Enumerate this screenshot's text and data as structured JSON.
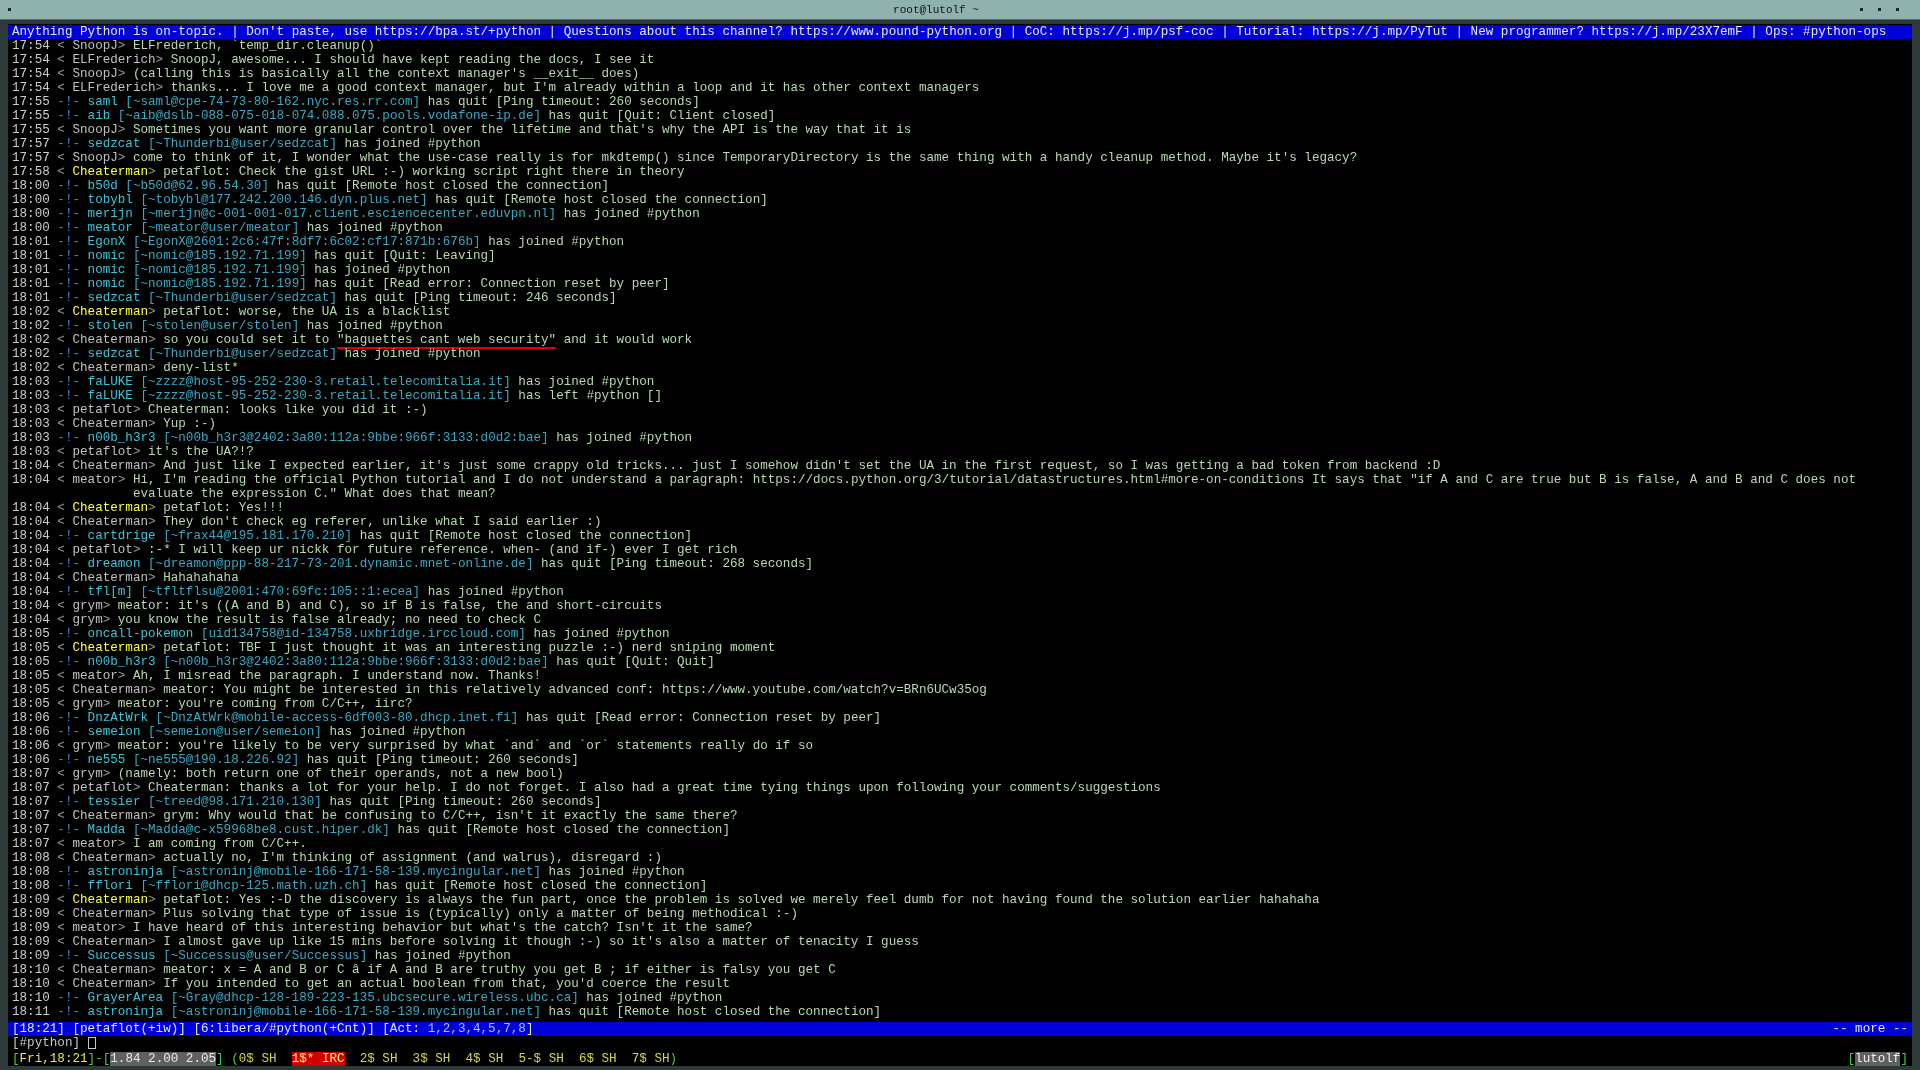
{
  "window": {
    "title": "root@lutolf ~"
  },
  "topic": "Anything Python is on-topic. | Don't paste, use https://bpa.st/+python | Questions about this channel? https://www.pound-python.org | CoC: https://j.mp/psf-coc | Tutorial: https://j.mp/PyTut | New programmer? https://j.mp/23X7emF | Ops: #python-ops",
  "lines": [
    {
      "kind": "msg",
      "time": "17:54",
      "open": "<",
      "nick": "SnoopJ",
      "close": ">",
      "text": "ELFrederich, `temp_dir.cleanup()`",
      "highlight": false
    },
    {
      "kind": "msg",
      "time": "17:54",
      "open": "<",
      "nick": "ELFrederich",
      "close": ">",
      "text": "SnoopJ, awesome... I should have kept reading the docs, I see it",
      "highlight": false
    },
    {
      "kind": "msg",
      "time": "17:54",
      "open": "<",
      "nick": "SnoopJ",
      "close": ">",
      "text": "(calling this is basically all the context manager's __exit__ does)",
      "highlight": false
    },
    {
      "kind": "msg",
      "time": "17:54",
      "open": "<",
      "nick": "ELFrederich",
      "close": ">",
      "text": "thanks... I love me a good context manager, but I'm already within a loop and it has other context managers",
      "highlight": false
    },
    {
      "kind": "event",
      "time": "17:55",
      "marker": "-!-",
      "nick": "saml",
      "host": "[~saml@cpe-74-73-80-162.nyc.res.rr.com]",
      "action": "has quit",
      "reason": "[Ping timeout: 260 seconds]"
    },
    {
      "kind": "event",
      "time": "17:55",
      "marker": "-!-",
      "nick": "aib",
      "host": "[~aib@dslb-088-075-018-074.088.075.pools.vodafone-ip.de]",
      "action": "has quit",
      "reason": "[Quit: Client closed]"
    },
    {
      "kind": "msg",
      "time": "17:55",
      "open": "<",
      "nick": "SnoopJ",
      "close": ">",
      "text": "Sometimes you want more granular control over the lifetime and that's why the API is the way that it is",
      "highlight": false
    },
    {
      "kind": "event",
      "time": "17:57",
      "marker": "-!-",
      "nick": "sedzcat",
      "host": "[~Thunderbi@user/sedzcat]",
      "action": "has joined #python"
    },
    {
      "kind": "msg",
      "time": "17:57",
      "open": "<",
      "nick": "SnoopJ",
      "close": ">",
      "text": "come to think of it, I wonder what the use-case really is for mkdtemp() since TemporaryDirectory is the same thing with a handy cleanup method. Maybe it's legacy?",
      "highlight": false
    },
    {
      "kind": "msg",
      "time": "17:58",
      "open": "<",
      "nick": "Cheaterman",
      "close": ">",
      "text": "petaflot: Check the gist URL :-) working script right there in theory",
      "highlight": true
    },
    {
      "kind": "event",
      "time": "18:00",
      "marker": "-!-",
      "nick": "b50d",
      "host": "[~b50d@62.96.54.30]",
      "action": "has quit",
      "reason": "[Remote host closed the connection]"
    },
    {
      "kind": "event",
      "time": "18:00",
      "marker": "-!-",
      "nick": "tobybl",
      "host": "[~tobybl@177.242.200.146.dyn.plus.net]",
      "action": "has quit",
      "reason": "[Remote host closed the connection]"
    },
    {
      "kind": "event",
      "time": "18:00",
      "marker": "-!-",
      "nick": "merijn",
      "host": "[~merijn@c-001-001-017.client.esciencecenter.eduvpn.nl]",
      "action": "has joined #python"
    },
    {
      "kind": "event",
      "time": "18:00",
      "marker": "-!-",
      "nick": "meator",
      "host": "[~meator@user/meator]",
      "action": "has joined #python"
    },
    {
      "kind": "event",
      "time": "18:01",
      "marker": "-!-",
      "nick": "EgonX",
      "host": "[~EgonX@2601:2c6:47f:8df7:6c02:cf17:871b:676b]",
      "action": "has joined #python"
    },
    {
      "kind": "event",
      "time": "18:01",
      "marker": "-!-",
      "nick": "nomic",
      "host": "[~nomic@185.192.71.199]",
      "action": "has quit",
      "reason": "[Quit: Leaving]"
    },
    {
      "kind": "event",
      "time": "18:01",
      "marker": "-!-",
      "nick": "nomic",
      "host": "[~nomic@185.192.71.199]",
      "action": "has joined #python"
    },
    {
      "kind": "event",
      "time": "18:01",
      "marker": "-!-",
      "nick": "nomic",
      "host": "[~nomic@185.192.71.199]",
      "action": "has quit",
      "reason": "[Read error: Connection reset by peer]"
    },
    {
      "kind": "event",
      "time": "18:01",
      "marker": "-!-",
      "nick": "sedzcat",
      "host": "[~Thunderbi@user/sedzcat]",
      "action": "has quit",
      "reason": "[Ping timeout: 246 seconds]"
    },
    {
      "kind": "msg",
      "time": "18:02",
      "open": "<",
      "nick": "Cheaterman",
      "close": ">",
      "text": "petaflot: worse, the UA is a blacklist",
      "highlight": true
    },
    {
      "kind": "event",
      "time": "18:02",
      "marker": "-!-",
      "nick": "stolen",
      "host": "[~stolen@user/stolen]",
      "action": "has joined #python"
    },
    {
      "kind": "msg",
      "time": "18:02",
      "open": "<",
      "nick": "Cheaterman",
      "close": ">",
      "text": "so you could set it to",
      "underlined": "\"baguettes cant web security\"",
      "text_after": "and it would work",
      "highlight": false
    },
    {
      "kind": "event",
      "time": "18:02",
      "marker": "-!-",
      "nick": "sedzcat",
      "host": "[~Thunderbi@user/sedzcat]",
      "action": "has joined #python"
    },
    {
      "kind": "msg",
      "time": "18:02",
      "open": "<",
      "nick": "Cheaterman",
      "close": ">",
      "text": "deny-list*",
      "highlight": false
    },
    {
      "kind": "event",
      "time": "18:03",
      "marker": "-!-",
      "nick": "faLUKE",
      "host": "[~zzzz@host-95-252-230-3.retail.telecomitalia.it]",
      "action": "has joined #python"
    },
    {
      "kind": "event",
      "time": "18:03",
      "marker": "-!-",
      "nick": "faLUKE",
      "host": "[~zzzz@host-95-252-230-3.retail.telecomitalia.it]",
      "action": "has left #python",
      "reason": "[]"
    },
    {
      "kind": "msg",
      "time": "18:03",
      "open": "<",
      "nick": "petaflot",
      "close": ">",
      "text": "Cheaterman: looks like you did it :-)",
      "highlight": false
    },
    {
      "kind": "msg",
      "time": "18:03",
      "open": "<",
      "nick": "Cheaterman",
      "close": ">",
      "text": "Yup :-)",
      "highlight": false
    },
    {
      "kind": "event",
      "time": "18:03",
      "marker": "-!-",
      "nick": "n00b_h3r3",
      "host": "[~n00b_h3r3@2402:3a80:112a:9bbe:966f:3133:d0d2:bae]",
      "action": "has joined #python"
    },
    {
      "kind": "msg",
      "time": "18:03",
      "open": "<",
      "nick": "petaflot",
      "close": ">",
      "text": "it's the UA?!?",
      "highlight": false
    },
    {
      "kind": "msg",
      "time": "18:04",
      "open": "<",
      "nick": "Cheaterman",
      "close": ">",
      "text": "And just like I expected earlier, it's just some crappy old tricks... just I somehow didn't set the UA in the first request, so I was getting a bad token from backend :D",
      "highlight": false
    },
    {
      "kind": "msg",
      "time": "18:04",
      "open": "<",
      "nick": "meator",
      "close": ">",
      "text": "Hi, I'm reading the official Python tutorial and I do not understand a paragraph: https://docs.python.org/3/tutorial/datastructures.html#more-on-conditions It says that \"if A and C are true but B is false, A and B and C does not evaluate the expression C.\" What does that mean?",
      "highlight": false
    },
    {
      "kind": "msg",
      "time": "18:04",
      "open": "<",
      "nick": "Cheaterman",
      "close": ">",
      "text": "petaflot: Yes!!!",
      "highlight": true
    },
    {
      "kind": "msg",
      "time": "18:04",
      "open": "<",
      "nick": "Cheaterman",
      "close": ">",
      "text": "They don't check eg referer, unlike what I said earlier :)",
      "highlight": false
    },
    {
      "kind": "event",
      "time": "18:04",
      "marker": "-!-",
      "nick": "cartdrige",
      "host": "[~frax44@195.181.170.210]",
      "action": "has quit",
      "reason": "[Remote host closed the connection]"
    },
    {
      "kind": "msg",
      "time": "18:04",
      "open": "<",
      "nick": "petaflot",
      "close": ">",
      "text": ":-* I will keep ur nickk for future reference. when- (and if-) ever I get rich",
      "highlight": false
    },
    {
      "kind": "event",
      "time": "18:04",
      "marker": "-!-",
      "nick": "dreamon",
      "host": "[~dreamon@ppp-88-217-73-201.dynamic.mnet-online.de]",
      "action": "has quit",
      "reason": "[Ping timeout: 268 seconds]"
    },
    {
      "kind": "msg",
      "time": "18:04",
      "open": "<",
      "nick": "Cheaterman",
      "close": ">",
      "text": "Hahahahaha",
      "highlight": false
    },
    {
      "kind": "event",
      "time": "18:04",
      "marker": "-!-",
      "nick": "tfl[m]",
      "host": "[~tfltflsu@2001:470:69fc:105::1:ecea]",
      "action": "has joined #python"
    },
    {
      "kind": "msg",
      "time": "18:04",
      "open": "<",
      "nick": "grym",
      "close": ">",
      "text": "meator: it's ((A and B) and C), so if B is false, the and short-circuits",
      "highlight": false
    },
    {
      "kind": "msg",
      "time": "18:04",
      "open": "<",
      "nick": "grym",
      "close": ">",
      "text": "you know the result is false already; no need to check C",
      "highlight": false
    },
    {
      "kind": "event",
      "time": "18:05",
      "marker": "-!-",
      "nick": "oncall-pokemon",
      "host": "[uid134758@id-134758.uxbridge.irccloud.com]",
      "action": "has joined #python"
    },
    {
      "kind": "msg",
      "time": "18:05",
      "open": "<",
      "nick": "Cheaterman",
      "close": ">",
      "text": "petaflot: TBF I just thought it was an interesting puzzle :-) nerd sniping moment",
      "highlight": true
    },
    {
      "kind": "event",
      "time": "18:05",
      "marker": "-!-",
      "nick": "n00b_h3r3",
      "host": "[~n00b_h3r3@2402:3a80:112a:9bbe:966f:3133:d0d2:bae]",
      "action": "has quit",
      "reason": "[Quit: Quit]"
    },
    {
      "kind": "msg",
      "time": "18:05",
      "open": "<",
      "nick": "meator",
      "close": ">",
      "text": "Ah, I misread the paragraph. I understand now. Thanks!",
      "highlight": false
    },
    {
      "kind": "msg",
      "time": "18:05",
      "open": "<",
      "nick": "Cheaterman",
      "close": ">",
      "text": "meator: You might be interested in this relatively advanced conf: https://www.youtube.com/watch?v=BRn6UCw35og",
      "highlight": false
    },
    {
      "kind": "msg",
      "time": "18:05",
      "open": "<",
      "nick": "grym",
      "close": ">",
      "text": "meator: you're coming from C/C++, iirc?",
      "highlight": false
    },
    {
      "kind": "event",
      "time": "18:06",
      "marker": "-!-",
      "nick": "DnzAtWrk",
      "host": "[~DnzAtWrk@mobile-access-6df003-80.dhcp.inet.fi]",
      "action": "has quit",
      "reason": "[Read error: Connection reset by peer]"
    },
    {
      "kind": "event",
      "time": "18:06",
      "marker": "-!-",
      "nick": "semeion",
      "host": "[~semeion@user/semeion]",
      "action": "has joined #python"
    },
    {
      "kind": "msg",
      "time": "18:06",
      "open": "<",
      "nick": "grym",
      "close": ">",
      "text": "meator: you're likely to be very surprised by what `and` and `or` statements really do if so",
      "highlight": false
    },
    {
      "kind": "event",
      "time": "18:06",
      "marker": "-!-",
      "nick": "ne555",
      "host": "[~ne555@190.18.226.92]",
      "action": "has quit",
      "reason": "[Ping timeout: 260 seconds]"
    },
    {
      "kind": "msg",
      "time": "18:07",
      "open": "<",
      "nick": "grym",
      "close": ">",
      "text": "(namely: both return one of their operands, not a new bool)",
      "highlight": false
    },
    {
      "kind": "msg",
      "time": "18:07",
      "open": "<",
      "nick": "petaflot",
      "close": ">",
      "text": "Cheaterman: thanks a lot for your help. I do not forget. I also had a great time tying things upon following your comments/suggestions",
      "highlight": false
    },
    {
      "kind": "event",
      "time": "18:07",
      "marker": "-!-",
      "nick": "tessier",
      "host": "[~treed@98.171.210.130]",
      "action": "has quit",
      "reason": "[Ping timeout: 260 seconds]"
    },
    {
      "kind": "msg",
      "time": "18:07",
      "open": "<",
      "nick": "Cheaterman",
      "close": ">",
      "text": "grym: Why would that be confusing to C/C++, isn't it exactly the same there?",
      "highlight": false
    },
    {
      "kind": "event",
      "time": "18:07",
      "marker": "-!-",
      "nick": "Madda",
      "host": "[~Madda@c-x59968be8.cust.hiper.dk]",
      "action": "has quit",
      "reason": "[Remote host closed the connection]"
    },
    {
      "kind": "msg",
      "time": "18:07",
      "open": "<",
      "nick": "meator",
      "close": ">",
      "text": "I am coming from C/C++.",
      "highlight": false
    },
    {
      "kind": "msg",
      "time": "18:08",
      "open": "<",
      "nick": "Cheaterman",
      "close": ">",
      "text": "actually no, I'm thinking of assignment (and walrus), disregard :)",
      "highlight": false
    },
    {
      "kind": "event",
      "time": "18:08",
      "marker": "-!-",
      "nick": "astroninja",
      "host": "[~astroninj@mobile-166-171-58-139.mycingular.net]",
      "action": "has joined #python"
    },
    {
      "kind": "event",
      "time": "18:08",
      "marker": "-!-",
      "nick": "fflori",
      "host": "[~fflori@dhcp-125.math.uzh.ch]",
      "action": "has quit",
      "reason": "[Remote host closed the connection]"
    },
    {
      "kind": "msg",
      "time": "18:09",
      "open": "<",
      "nick": "Cheaterman",
      "close": ">",
      "text": "petaflot: Yes :-D the discovery is always the fun part, once the problem is solved we merely feel dumb for not having found the solution earlier hahahaha",
      "highlight": true
    },
    {
      "kind": "msg",
      "time": "18:09",
      "open": "<",
      "nick": "Cheaterman",
      "close": ">",
      "text": "Plus solving that type of issue is (typically) only a matter of being methodical :-)",
      "highlight": false
    },
    {
      "kind": "msg",
      "time": "18:09",
      "open": "<",
      "nick": "meator",
      "close": ">",
      "text": "I have heard of this interesting behavior but what's the catch? Isn't it the same?",
      "highlight": false
    },
    {
      "kind": "msg",
      "time": "18:09",
      "open": "<",
      "nick": "Cheaterman",
      "close": ">",
      "text": "I almost gave up like 15 mins before solving it though :-) so it's also a matter of tenacity I guess",
      "highlight": false
    },
    {
      "kind": "event",
      "time": "18:09",
      "marker": "-!-",
      "nick": "Successus",
      "host": "[~Successus@user/Successus]",
      "action": "has joined #python"
    },
    {
      "kind": "msg",
      "time": "18:10",
      "open": "<",
      "nick": "Cheaterman",
      "close": ">",
      "text": "meator: x = A and B or C â if A and B are truthy you get B ; if either is falsy you get C",
      "highlight": false
    },
    {
      "kind": "msg",
      "time": "18:10",
      "open": "<",
      "nick": "Cheaterman",
      "close": ">",
      "text": "If you intended to get an actual boolean from that, you'd coerce the result",
      "highlight": false
    },
    {
      "kind": "event",
      "time": "18:10",
      "marker": "-!-",
      "nick": "GrayerArea",
      "host": "[~Gray@dhcp-128-189-223-135.ubcsecure.wireless.ubc.ca]",
      "action": "has joined #python"
    },
    {
      "kind": "event",
      "time": "18:11",
      "marker": "-!-",
      "nick": "astroninja",
      "host": "[~astroninj@mobile-166-171-58-139.mycingular.net]",
      "action": "has quit",
      "reason": "[Remote host closed the connection]"
    }
  ],
  "status_bar": {
    "items": [
      "[18:21]",
      "[petaflot(+iw)]",
      "[6:libera/#python(+Cnt)]"
    ],
    "act_open": "[Act:",
    "act": "1,2,3,4,5,7,8",
    "act_close": "]",
    "more": "-- more --"
  },
  "input": {
    "prompt": "[#python]"
  },
  "screen_bar": {
    "clock": {
      "open": "[",
      "text": "Fri,18:21",
      "close": "]"
    },
    "dash": "-",
    "load": {
      "open": "[",
      "text": "1.84 2.00 2.05",
      "close": "]"
    },
    "list_open": "(",
    "windows": [
      {
        "label": "0$ SH",
        "selected": false
      },
      {
        "label": "1$* IRC",
        "selected": true
      },
      {
        "label": "2$ SH",
        "selected": false
      },
      {
        "label": "3$ SH",
        "selected": false
      },
      {
        "label": "4$ SH",
        "selected": false
      },
      {
        "label": "5-$ SH",
        "selected": false
      },
      {
        "label": "6$ SH",
        "selected": false
      },
      {
        "label": "7$ SH",
        "selected": false
      }
    ],
    "list_close": ")",
    "host": {
      "open": "[",
      "text": "lutolf",
      "close": "]"
    }
  }
}
